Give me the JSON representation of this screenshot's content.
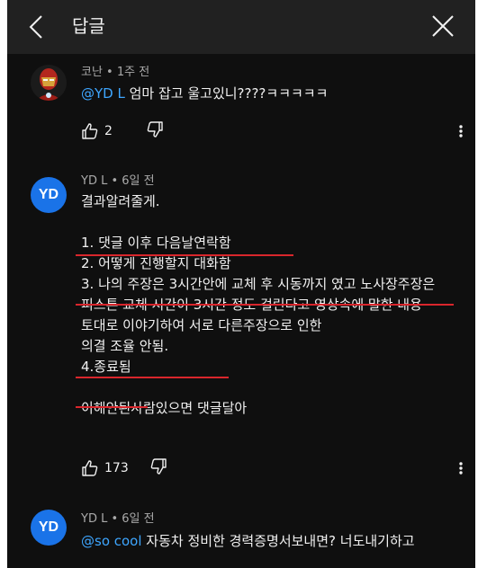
{
  "header": {
    "title": "답글"
  },
  "comments": [
    {
      "author_meta": "코난 • 1주 전",
      "mention": "@YD L",
      "text": " 엄마 잡고 울고있니????ㅋㅋㅋㅋㅋ",
      "likes": "2"
    },
    {
      "author_meta": "YD L • 6일 전",
      "avatar_text": "YD",
      "lines": [
        "결과알려줄게.",
        "",
        "1. 댓글 이후 다음날연락함",
        "2. 어떻게 진행할지 대화함",
        "3. 나의 주장은 3시간안에 교체 후 시동까지 였고 노사장주장은",
        "피스톤 교체 시간이 3시간 정도 걸린다고 영상속에 말한 내용",
        "토대로 이야기하여 서로 다른주장으로 인한",
        "의결 조율 안됨.",
        "4.종료됨",
        "",
        "이해안된사람있으면 댓글달아"
      ],
      "likes": "173"
    },
    {
      "author_meta": "YD L • 6일 전",
      "avatar_text": "YD",
      "mention": "@so cool",
      "text": "  자동차 정비한  경력증명서보내면? 너도내기하고"
    }
  ],
  "colors": {
    "background": "#0f0f0f",
    "topbar": "#212121",
    "mention": "#3ea6ff",
    "annotation_red": "#d9262c",
    "avatar_blue": "#1a73e8"
  }
}
